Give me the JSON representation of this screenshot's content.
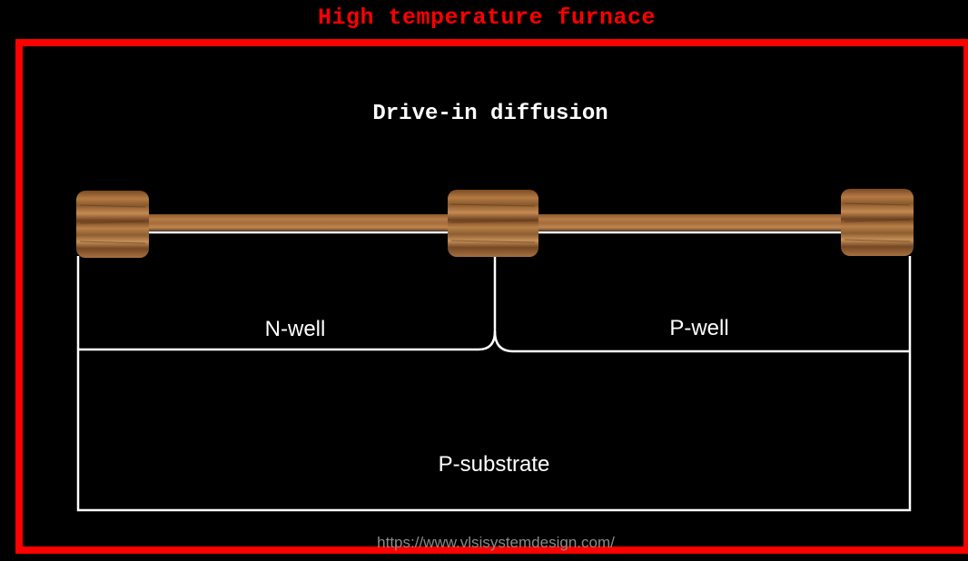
{
  "furnace": {
    "title": "High temperature furnace",
    "frame_color": "#ff0000"
  },
  "step": {
    "title": "Drive-in diffusion"
  },
  "regions": {
    "n_well": "N-well",
    "p_well": "P-well",
    "p_substrate": "P-substrate"
  },
  "oxide": {
    "color": "#a06a38"
  },
  "watermark": {
    "url": "https://www.vlsisystemdesign.com/"
  }
}
